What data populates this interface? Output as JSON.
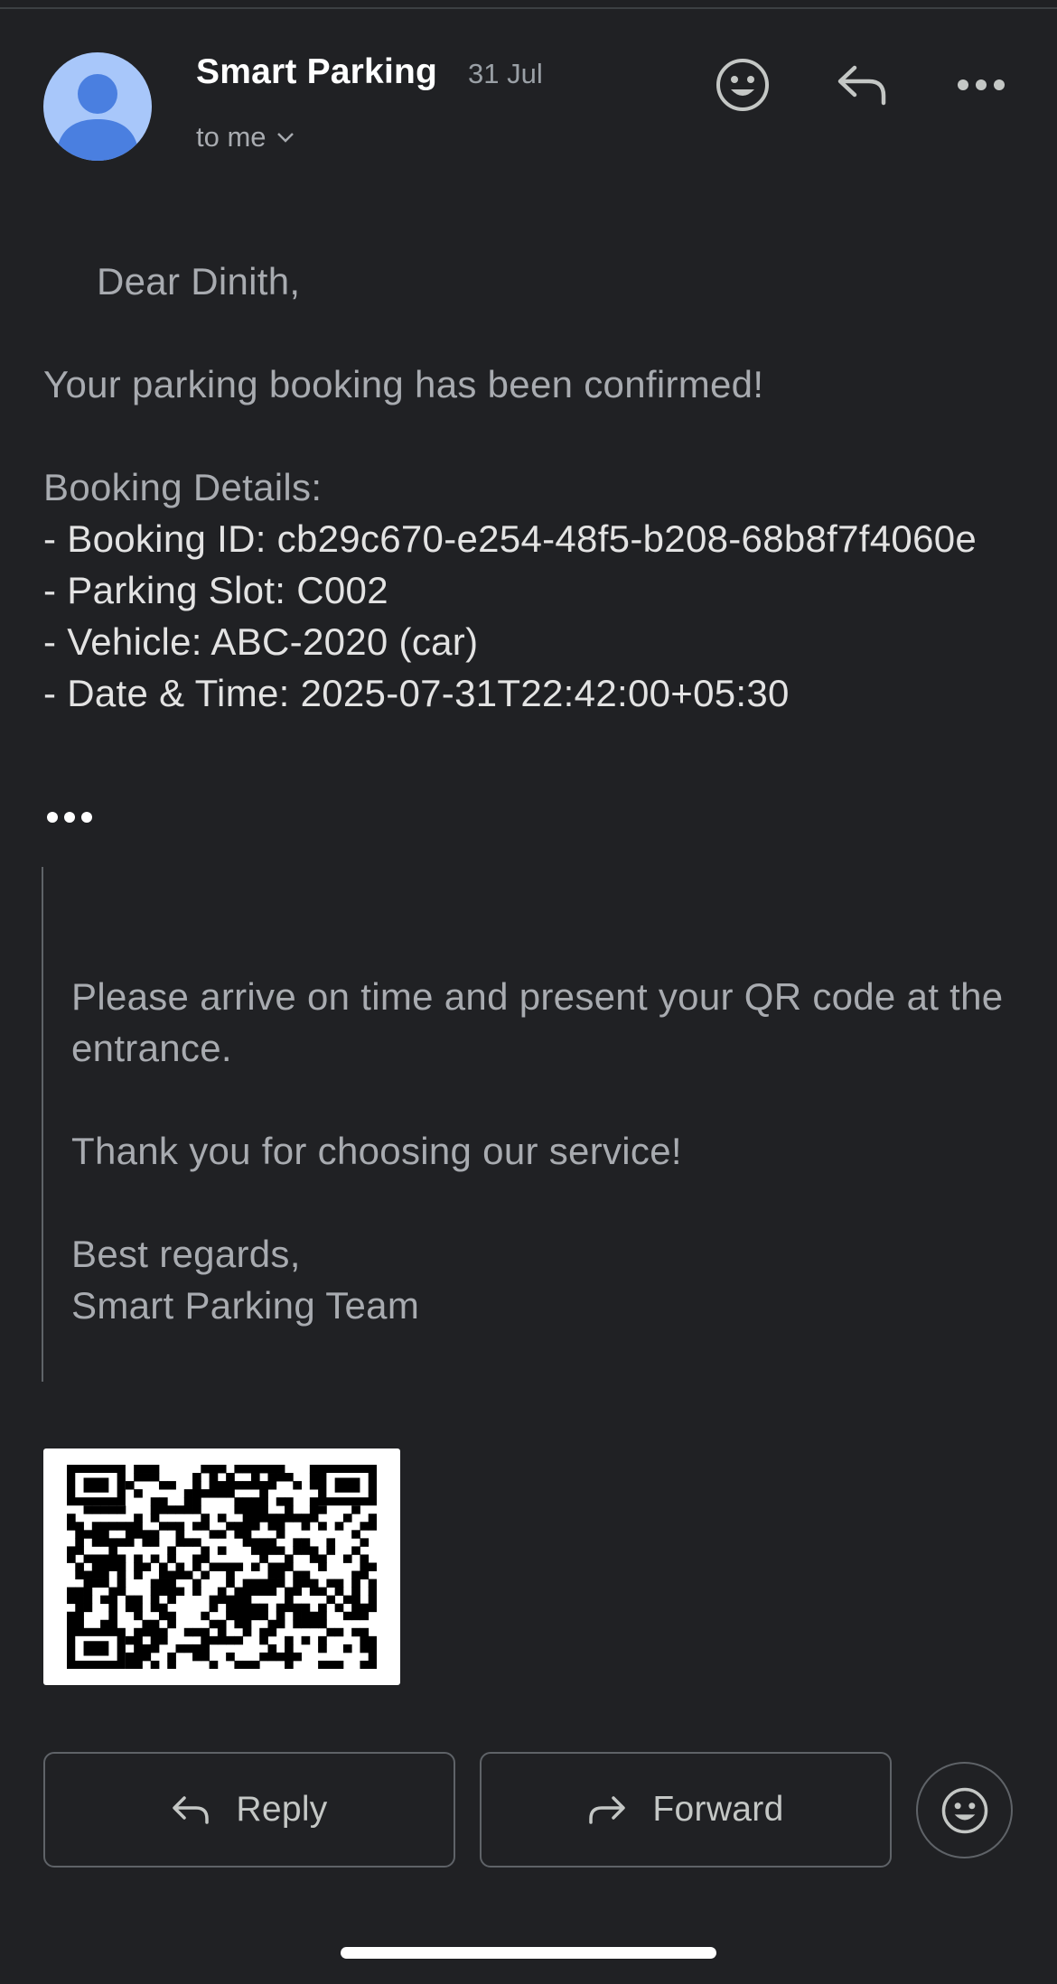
{
  "header": {
    "sender": "Smart Parking",
    "date": "31 Jul",
    "recipient": "to me"
  },
  "email": {
    "greeting": "Dear Dinith,",
    "confirmation": "Your parking booking has been confirmed!",
    "details_label": "Booking Details:",
    "details": [
      "- Booking ID: cb29c670-e254-48f5-b208-68b8f7f4060e",
      "- Parking Slot: C002",
      "- Vehicle: ABC-2020 (car)",
      "- Date & Time: 2025-07-31T22:42:00+05:30"
    ],
    "quoted": {
      "instruction": "Please arrive on time and present your QR code at the entrance.",
      "thanks": "Thank you for choosing our service!",
      "signoff_line1": "Best regards,",
      "signoff_line2": "Smart Parking Team"
    }
  },
  "actions": {
    "reply_label": "Reply",
    "forward_label": "Forward"
  },
  "icons": {
    "avatar": "person-icon",
    "reaction": "smiley-icon",
    "reply": "reply-arrow-icon",
    "more": "more-horizontal-icon",
    "expand": "chevron-down-icon",
    "forward": "forward-arrow-icon",
    "trimmed": "ellipsis-icon"
  },
  "colors": {
    "background": "#202124",
    "avatar_bg": "#a8c7fa",
    "avatar_fg": "#4a7fe0"
  }
}
